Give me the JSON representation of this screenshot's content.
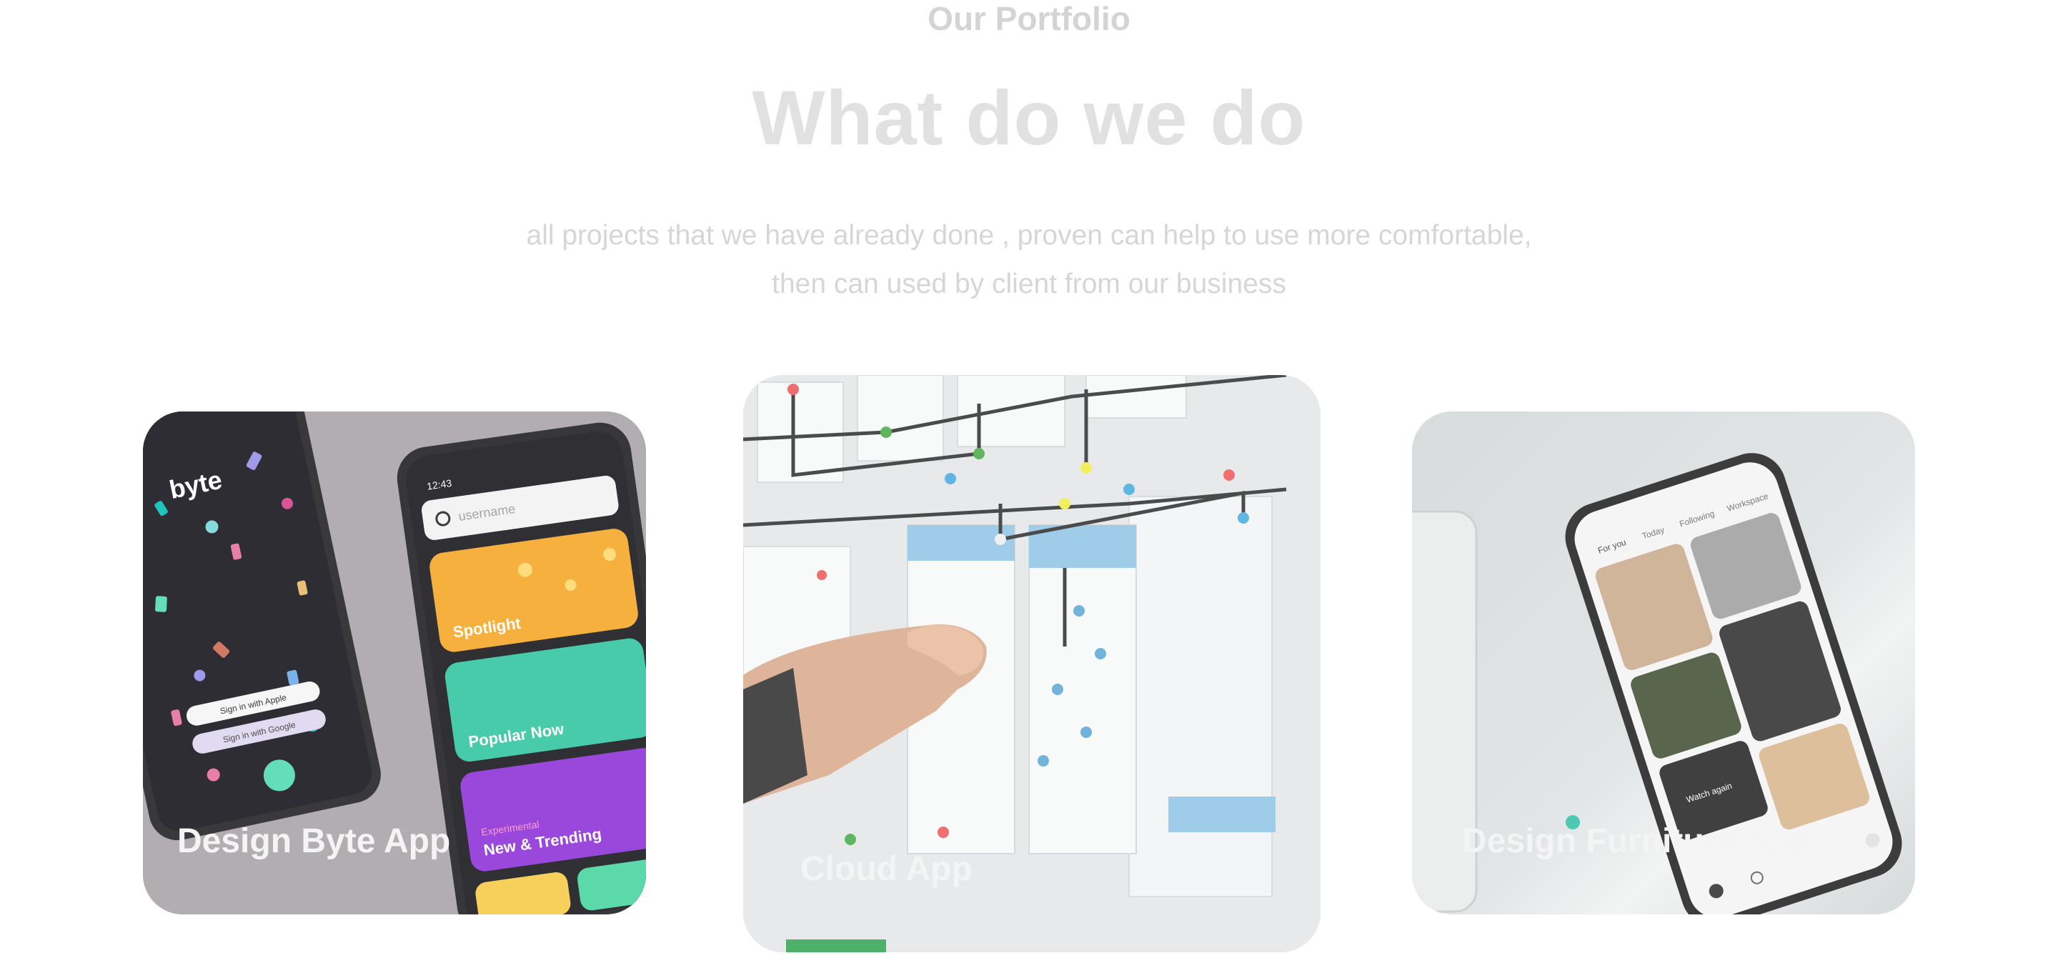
{
  "header": {
    "eyebrow": "Our Portfolio",
    "title": "What do we do",
    "subtitle": "all projects that we have already done , proven can help to use more comfortable, then can used by client from our business"
  },
  "projects": [
    {
      "title": "Design Byte App",
      "mockup": {
        "brand": "byte",
        "sign_in_apple": "Sign in with Apple",
        "sign_in_google": "Sign in with Google",
        "search_placeholder": "username",
        "status_time": "12:43",
        "categories": [
          "Spotlight",
          "Popular Now",
          "Experimental",
          "New & Trending"
        ]
      }
    },
    {
      "title": "Cloud App"
    },
    {
      "title": "Design Furniture App",
      "mockup": {
        "tabs": [
          "For you",
          "Today",
          "Following",
          "Workspace"
        ],
        "watch_label": "Watch again"
      }
    }
  ],
  "colors": {
    "heading": "#e1e1e1",
    "eyebrow": "#d4d4d4",
    "subtitle": "#d6d6d6",
    "card_label": "#f4f4f4",
    "byte_bg": "#a8a2a6",
    "spotlight": "#f5a623",
    "popular": "#2ec4a0",
    "trending": "#8b2fd6"
  }
}
